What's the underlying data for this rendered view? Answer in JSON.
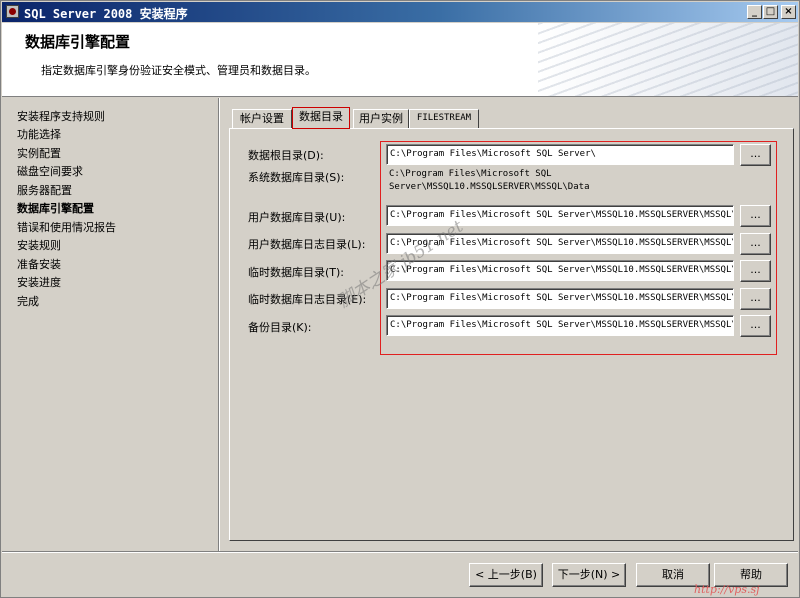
{
  "window": {
    "title": "SQL Server 2008 安装程序",
    "min_glyph": "_",
    "max_glyph": "□",
    "close_glyph": "×"
  },
  "header": {
    "title": "数据库引擎配置",
    "subtitle": "指定数据库引擎身份验证安全模式、管理员和数据目录。"
  },
  "nav": {
    "items": [
      {
        "label": "安装程序支持规则",
        "active": false
      },
      {
        "label": "功能选择",
        "active": false
      },
      {
        "label": "实例配置",
        "active": false
      },
      {
        "label": "磁盘空间要求",
        "active": false
      },
      {
        "label": "服务器配置",
        "active": false
      },
      {
        "label": "数据库引擎配置",
        "active": true
      },
      {
        "label": "错误和使用情况报告",
        "active": false
      },
      {
        "label": "安装规则",
        "active": false
      },
      {
        "label": "准备安装",
        "active": false
      },
      {
        "label": "安装进度",
        "active": false
      },
      {
        "label": "完成",
        "active": false
      }
    ]
  },
  "tabs": [
    {
      "label": "帐户设置",
      "selected": false
    },
    {
      "label": "数据目录",
      "selected": true
    },
    {
      "label": "用户实例",
      "selected": false
    },
    {
      "label": "FILESTREAM",
      "selected": false
    }
  ],
  "data_dirs": {
    "root": {
      "label": "数据根目录(D):",
      "value": "C:\\Program Files\\Microsoft SQL Server\\"
    },
    "system": {
      "label": "系统数据库目录(S):",
      "line1": "C:\\Program Files\\Microsoft SQL",
      "line2": "Server\\MSSQL10.MSSQLSERVER\\MSSQL\\Data"
    },
    "user_db": {
      "label": "用户数据库目录(U):",
      "value": "C:\\Program Files\\Microsoft SQL Server\\MSSQL10.MSSQLSERVER\\MSSQL\\Data"
    },
    "user_log": {
      "label": "用户数据库日志目录(L):",
      "value": "C:\\Program Files\\Microsoft SQL Server\\MSSQL10.MSSQLSERVER\\MSSQL\\Data"
    },
    "temp_db": {
      "label": "临时数据库目录(T):",
      "value": "C:\\Program Files\\Microsoft SQL Server\\MSSQL10.MSSQLSERVER\\MSSQL\\Data"
    },
    "temp_log": {
      "label": "临时数据库日志目录(E):",
      "value": "C:\\Program Files\\Microsoft SQL Server\\MSSQL10.MSSQLSERVER\\MSSQL\\Data"
    },
    "backup": {
      "label": "备份目录(K):",
      "value": "C:\\Program Files\\Microsoft SQL Server\\MSSQL10.MSSQLSERVER\\MSSQL\\Backup"
    },
    "browse_label": "..."
  },
  "footer": {
    "back": "< 上一步(B)",
    "next": "下一步(N) >",
    "cancel": "取消",
    "help": "帮助"
  },
  "watermarks": {
    "diagonal": "脚本之家 jb51.net",
    "url": "http://vps.sj"
  },
  "colors": {
    "highlight": "#e02020",
    "title_bar": "#0a246a"
  }
}
